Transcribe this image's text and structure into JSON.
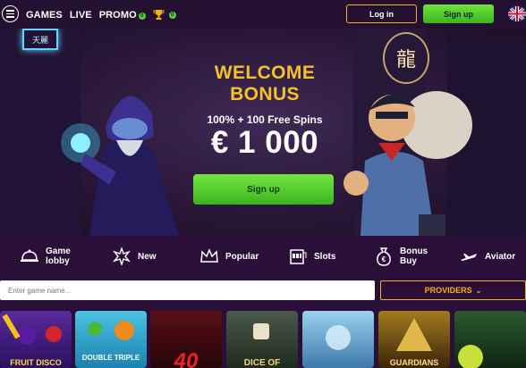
{
  "header": {
    "nav": [
      {
        "label": "GAMES"
      },
      {
        "label": "LIVE"
      },
      {
        "label": "PROMO",
        "badge": "0"
      }
    ],
    "trophy_badge": "0",
    "login_label": "Log in",
    "signup_label": "Sign up"
  },
  "hero": {
    "sign_left": "天麗",
    "sign_right": "龍",
    "title_line1": "WELCOME",
    "title_line2": "BONUS",
    "subtitle": "100% + 100 Free Spins",
    "amount": "€ 1 000",
    "signup_label": "Sign up"
  },
  "categories": [
    {
      "line1": "Game",
      "line2": "lobby",
      "icon": "bell-icon"
    },
    {
      "line1": "New",
      "line2": "",
      "icon": "star-burst-icon"
    },
    {
      "line1": "Popular",
      "line2": "",
      "icon": "crown-icon"
    },
    {
      "line1": "Slots",
      "line2": "",
      "icon": "slot-machine-icon"
    },
    {
      "line1": "Bonus",
      "line2": "Buy",
      "icon": "money-bag-icon"
    },
    {
      "line1": "Aviator",
      "line2": "",
      "icon": "plane-icon"
    }
  ],
  "search": {
    "placeholder": "Enter game name..."
  },
  "providers_label": "PROVIDERS",
  "games": [
    {
      "label": "FRUIT DISCO",
      "color": "#3a1b6e"
    },
    {
      "label": "DOUBLE TRIPLE",
      "color": "#2aa3c9"
    },
    {
      "label": "40",
      "color": "#3b0b12"
    },
    {
      "label": "DICE OF",
      "color": "#3b4a3a"
    },
    {
      "label": "",
      "color": "#6aa9d4"
    },
    {
      "label": "GUARDIANS",
      "color": "#5a3a10"
    },
    {
      "label": "",
      "color": "#1f3a22"
    }
  ],
  "colors": {
    "accent": "#f3b31c",
    "signup": "#4fc52a",
    "background": "#2a0f38"
  }
}
